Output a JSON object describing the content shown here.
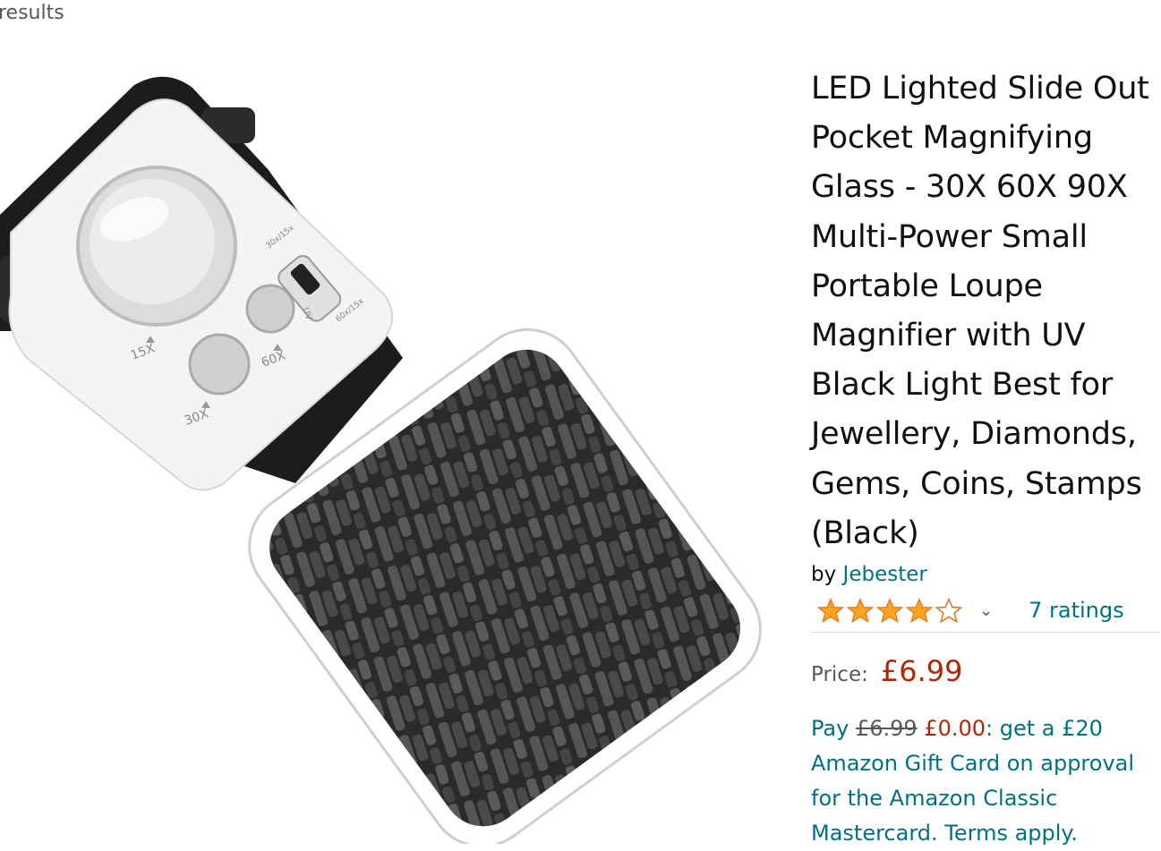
{
  "breadcrumb": {
    "text": "results"
  },
  "product": {
    "title_lines": [
      "LED Lighted Slide Out",
      "Pocket Magnifying",
      "Glass - 30X 60X 90X",
      "Multi-Power Small",
      "Portable Loupe",
      "Magnifier with UV",
      "Black Light Best for",
      "Jewellery, Diamonds,",
      "Gems, Coins, Stamps",
      "(Black)"
    ],
    "byline_prefix": "by",
    "brand": "Jebester",
    "rating_stars": 4,
    "ratings_count": "7 ratings",
    "price_label": "Price:",
    "price": "£6.99",
    "promo": {
      "pay": "Pay",
      "old_price": "£6.99",
      "new_price": "£0.00",
      "rest": ": get a £20",
      "line2": "Amazon Gift Card on approval",
      "line3": "for the Amazon Classic",
      "line4": "Mastercard. Terms apply."
    },
    "image_labels": {
      "mag_15": "15X",
      "mag_30": "30X",
      "mag_60": "60X",
      "uv": "UV",
      "switch_top": "30x/15x",
      "switch_bottom": "60x/15x"
    }
  },
  "colors": {
    "link": "#007185",
    "price": "#b12704",
    "star": "#ffa41c"
  }
}
